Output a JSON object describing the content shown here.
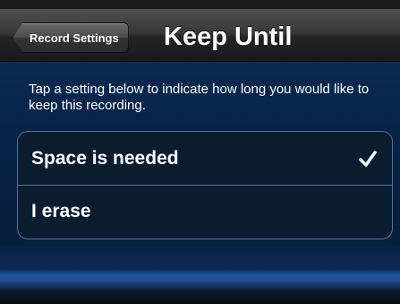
{
  "navbar": {
    "back_label": "Record Settings",
    "title": "Keep Until"
  },
  "instructions": "Tap a setting below to indicate how long you would like to keep this recording.",
  "options": [
    {
      "label": "Space is needed",
      "selected": true
    },
    {
      "label": "I erase",
      "selected": false
    }
  ],
  "icons": {
    "selected_indicator": "checkmark-icon"
  }
}
